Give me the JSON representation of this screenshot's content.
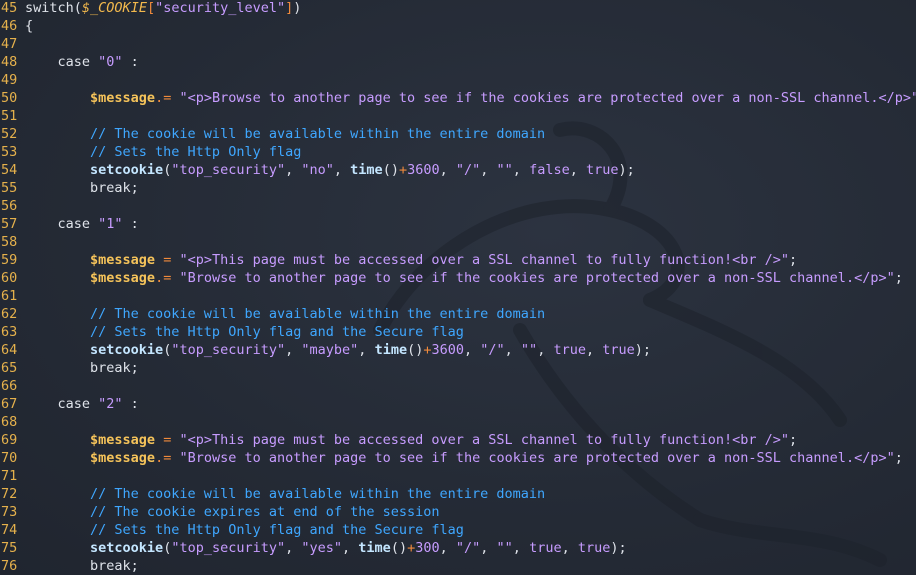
{
  "editor": {
    "language": "php",
    "theme_colors": {
      "background": "#262c38",
      "line_number": "#e5b14c",
      "string": "#c79cff",
      "comment": "#3fa7ff",
      "variable": "#f5c35a",
      "operator": "#f08a3c"
    },
    "watermark": "dragon-logo",
    "lines": [
      {
        "n": "45",
        "tokens": [
          {
            "t": "switch",
            "c": "p"
          },
          {
            "t": "(",
            "c": "p"
          },
          {
            "t": "$_COOKIE",
            "c": "gl"
          },
          {
            "t": "[",
            "c": "op"
          },
          {
            "t": "\"security_level\"",
            "c": "str"
          },
          {
            "t": "]",
            "c": "op"
          },
          {
            "t": ")",
            "c": "p"
          }
        ]
      },
      {
        "n": "46",
        "tokens": [
          {
            "t": "{",
            "c": "p"
          }
        ]
      },
      {
        "n": "47",
        "tokens": []
      },
      {
        "n": "48",
        "tokens": [
          {
            "t": "    case ",
            "c": "p"
          },
          {
            "t": "\"0\"",
            "c": "str"
          },
          {
            "t": " :",
            "c": "p"
          }
        ]
      },
      {
        "n": "49",
        "tokens": []
      },
      {
        "n": "50",
        "tokens": [
          {
            "t": "        ",
            "c": "p"
          },
          {
            "t": "$message",
            "c": "var"
          },
          {
            "t": ".=",
            "c": "op"
          },
          {
            "t": " ",
            "c": "p"
          },
          {
            "t": "\"<p>Browse to another page to see if the cookies are protected over a non-SSL channel.</p>\"",
            "c": "str"
          },
          {
            "t": ";",
            "c": "p"
          }
        ]
      },
      {
        "n": "51",
        "tokens": []
      },
      {
        "n": "52",
        "tokens": [
          {
            "t": "        // The cookie will be available within the entire domain",
            "c": "cm"
          }
        ]
      },
      {
        "n": "53",
        "tokens": [
          {
            "t": "        // Sets the Http Only flag",
            "c": "cm"
          }
        ]
      },
      {
        "n": "54",
        "tokens": [
          {
            "t": "        ",
            "c": "p"
          },
          {
            "t": "setcookie",
            "c": "fn"
          },
          {
            "t": "(",
            "c": "p"
          },
          {
            "t": "\"top_security\"",
            "c": "str"
          },
          {
            "t": ", ",
            "c": "p"
          },
          {
            "t": "\"no\"",
            "c": "str"
          },
          {
            "t": ", ",
            "c": "p"
          },
          {
            "t": "time",
            "c": "fn"
          },
          {
            "t": "()",
            "c": "p"
          },
          {
            "t": "+",
            "c": "op"
          },
          {
            "t": "3600",
            "c": "num"
          },
          {
            "t": ", ",
            "c": "p"
          },
          {
            "t": "\"/\"",
            "c": "str"
          },
          {
            "t": ", ",
            "c": "p"
          },
          {
            "t": "\"\"",
            "c": "str"
          },
          {
            "t": ", ",
            "c": "p"
          },
          {
            "t": "false",
            "c": "bool"
          },
          {
            "t": ", ",
            "c": "p"
          },
          {
            "t": "true",
            "c": "bool"
          },
          {
            "t": ");",
            "c": "p"
          }
        ]
      },
      {
        "n": "55",
        "tokens": [
          {
            "t": "        break;",
            "c": "p"
          }
        ]
      },
      {
        "n": "56",
        "tokens": []
      },
      {
        "n": "57",
        "tokens": [
          {
            "t": "    case ",
            "c": "p"
          },
          {
            "t": "\"1\"",
            "c": "str"
          },
          {
            "t": " :",
            "c": "p"
          }
        ]
      },
      {
        "n": "58",
        "tokens": []
      },
      {
        "n": "59",
        "tokens": [
          {
            "t": "        ",
            "c": "p"
          },
          {
            "t": "$message",
            "c": "var"
          },
          {
            "t": " = ",
            "c": "op"
          },
          {
            "t": "\"<p>This page must be accessed over a SSL channel to fully function!<br />\"",
            "c": "str"
          },
          {
            "t": ";",
            "c": "p"
          }
        ]
      },
      {
        "n": "60",
        "tokens": [
          {
            "t": "        ",
            "c": "p"
          },
          {
            "t": "$message",
            "c": "var"
          },
          {
            "t": ".=",
            "c": "op"
          },
          {
            "t": " ",
            "c": "p"
          },
          {
            "t": "\"Browse to another page to see if the cookies are protected over a non-SSL channel.</p>\"",
            "c": "str"
          },
          {
            "t": ";",
            "c": "p"
          }
        ]
      },
      {
        "n": "61",
        "tokens": []
      },
      {
        "n": "62",
        "tokens": [
          {
            "t": "        // The cookie will be available within the entire domain",
            "c": "cm"
          }
        ]
      },
      {
        "n": "63",
        "tokens": [
          {
            "t": "        // Sets the Http Only flag and the Secure flag",
            "c": "cm"
          }
        ]
      },
      {
        "n": "64",
        "tokens": [
          {
            "t": "        ",
            "c": "p"
          },
          {
            "t": "setcookie",
            "c": "fn"
          },
          {
            "t": "(",
            "c": "p"
          },
          {
            "t": "\"top_security\"",
            "c": "str"
          },
          {
            "t": ", ",
            "c": "p"
          },
          {
            "t": "\"maybe\"",
            "c": "str"
          },
          {
            "t": ", ",
            "c": "p"
          },
          {
            "t": "time",
            "c": "fn"
          },
          {
            "t": "()",
            "c": "p"
          },
          {
            "t": "+",
            "c": "op"
          },
          {
            "t": "3600",
            "c": "num"
          },
          {
            "t": ", ",
            "c": "p"
          },
          {
            "t": "\"/\"",
            "c": "str"
          },
          {
            "t": ", ",
            "c": "p"
          },
          {
            "t": "\"\"",
            "c": "str"
          },
          {
            "t": ", ",
            "c": "p"
          },
          {
            "t": "true",
            "c": "bool"
          },
          {
            "t": ", ",
            "c": "p"
          },
          {
            "t": "true",
            "c": "bool"
          },
          {
            "t": ");",
            "c": "p"
          }
        ]
      },
      {
        "n": "65",
        "tokens": [
          {
            "t": "        break;",
            "c": "p"
          }
        ]
      },
      {
        "n": "66",
        "tokens": []
      },
      {
        "n": "67",
        "tokens": [
          {
            "t": "    case ",
            "c": "p"
          },
          {
            "t": "\"2\"",
            "c": "str"
          },
          {
            "t": " :",
            "c": "p"
          }
        ]
      },
      {
        "n": "68",
        "tokens": []
      },
      {
        "n": "69",
        "tokens": [
          {
            "t": "        ",
            "c": "p"
          },
          {
            "t": "$message",
            "c": "var"
          },
          {
            "t": " = ",
            "c": "op"
          },
          {
            "t": "\"<p>This page must be accessed over a SSL channel to fully function!<br />\"",
            "c": "str"
          },
          {
            "t": ";",
            "c": "p"
          }
        ]
      },
      {
        "n": "70",
        "tokens": [
          {
            "t": "        ",
            "c": "p"
          },
          {
            "t": "$message",
            "c": "var"
          },
          {
            "t": ".=",
            "c": "op"
          },
          {
            "t": " ",
            "c": "p"
          },
          {
            "t": "\"Browse to another page to see if the cookies are protected over a non-SSL channel.</p>\"",
            "c": "str"
          },
          {
            "t": ";",
            "c": "p"
          }
        ]
      },
      {
        "n": "71",
        "tokens": []
      },
      {
        "n": "72",
        "tokens": [
          {
            "t": "        // The cookie will be available within the entire domain",
            "c": "cm"
          }
        ]
      },
      {
        "n": "73",
        "tokens": [
          {
            "t": "        // The cookie expires at end of the session",
            "c": "cm"
          }
        ]
      },
      {
        "n": "74",
        "tokens": [
          {
            "t": "        // Sets the Http Only flag and the Secure flag",
            "c": "cm"
          }
        ]
      },
      {
        "n": "75",
        "tokens": [
          {
            "t": "        ",
            "c": "p"
          },
          {
            "t": "setcookie",
            "c": "fn"
          },
          {
            "t": "(",
            "c": "p"
          },
          {
            "t": "\"top_security\"",
            "c": "str"
          },
          {
            "t": ", ",
            "c": "p"
          },
          {
            "t": "\"yes\"",
            "c": "str"
          },
          {
            "t": ", ",
            "c": "p"
          },
          {
            "t": "time",
            "c": "fn"
          },
          {
            "t": "()",
            "c": "p"
          },
          {
            "t": "+",
            "c": "op"
          },
          {
            "t": "300",
            "c": "num"
          },
          {
            "t": ", ",
            "c": "p"
          },
          {
            "t": "\"/\"",
            "c": "str"
          },
          {
            "t": ", ",
            "c": "p"
          },
          {
            "t": "\"\"",
            "c": "str"
          },
          {
            "t": ", ",
            "c": "p"
          },
          {
            "t": "true",
            "c": "bool"
          },
          {
            "t": ", ",
            "c": "p"
          },
          {
            "t": "true",
            "c": "bool"
          },
          {
            "t": ");",
            "c": "p"
          }
        ]
      },
      {
        "n": "76",
        "tokens": [
          {
            "t": "        break;",
            "c": "p"
          }
        ]
      }
    ]
  }
}
